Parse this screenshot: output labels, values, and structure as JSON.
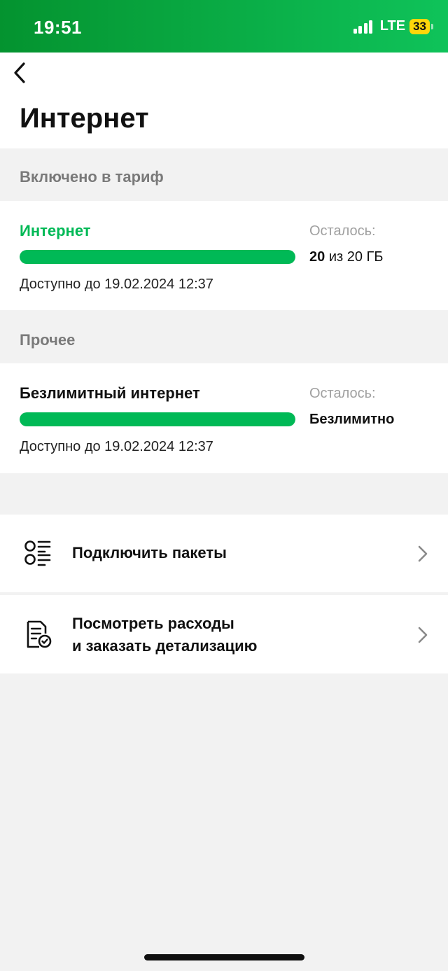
{
  "status_bar": {
    "time": "19:51",
    "network": "LTE",
    "battery": "33"
  },
  "header": {
    "back_icon": "chevron-left-icon",
    "title": "Интернет"
  },
  "sections": [
    {
      "label": "Включено в тариф",
      "service": {
        "name": "Интернет",
        "name_color": "#00b956",
        "valid_until": "Доступно до 19.02.2024 12:37",
        "remaining_label": "Осталось:",
        "remaining_amount": "20",
        "remaining_total": "из 20 ГБ",
        "progress_fraction": 1.0
      }
    },
    {
      "label": "Прочее",
      "service": {
        "name": "Безлимитный интернет",
        "name_color": "#111111",
        "valid_until": "Доступно до 19.02.2024 12:37",
        "remaining_label": "Осталось:",
        "remaining_value": "Безлимитно",
        "progress_fraction": 1.0
      }
    }
  ],
  "actions": [
    {
      "icon": "packages-list-icon",
      "label": "Подключить пакеты"
    },
    {
      "icon": "document-check-icon",
      "label_line1": "Посмотреть расходы",
      "label_line2": "и заказать детализацию"
    }
  ],
  "colors": {
    "accent": "#00b956",
    "status_bar_start": "#04932f",
    "status_bar_end": "#0fc35a",
    "battery": "#ffd60a"
  }
}
